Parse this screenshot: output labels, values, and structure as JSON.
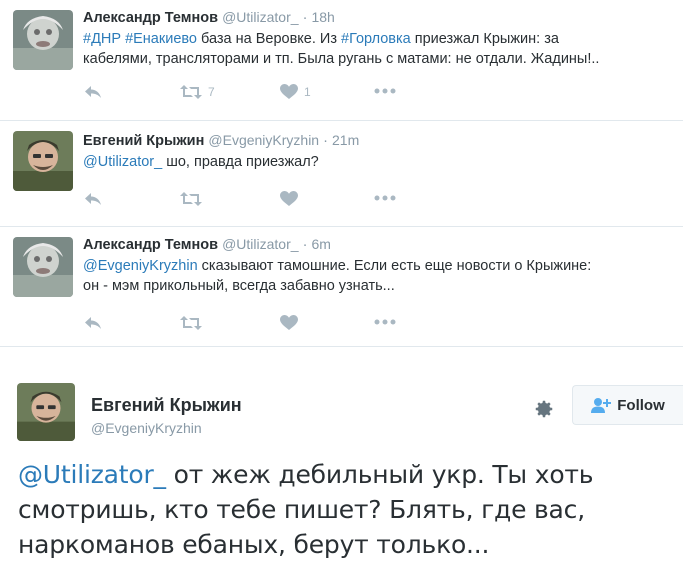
{
  "tweets": [
    {
      "name": "Александр Темнов",
      "handle": "@Utilizator_",
      "time": "18h",
      "hashtags": [
        "#ДНР",
        "#Енакиево"
      ],
      "text_part1": " база на Веровке. Из ",
      "hashtag2": "#Горловка",
      "text_part2": " приезжал Крыжин: за",
      "line2": "кабелями, трансляторами и тп. Была ругань с матами: не отдали. Жадины!..",
      "retweets": "7",
      "likes": "1"
    },
    {
      "name": "Евгений Крыжин",
      "handle": "@EvgeniyKryzhin",
      "time": "21m",
      "mention": "@Utilizator_",
      "text": " шо, правда приезжал?"
    },
    {
      "name": "Александр Темнов",
      "handle": "@Utilizator_",
      "time": "6m",
      "mention": "@EvgeniyKryzhin",
      "text": " сказывают тамошние. Если есть еще новости о Крыжине:",
      "line2": "он - мэм прикольный, всегда забавно узнать..."
    }
  ],
  "main_tweet": {
    "name": "Евгений Крыжин",
    "handle": "@EvgeniyKryzhin",
    "follow_label": "Follow",
    "mention": "@Utilizator_",
    "text_line1": " от жеж дебильный укр. Ты хоть",
    "text_line2": "смотришь, кто тебе пишет? Блять, где вас,",
    "text_line3": "наркоманов ебаных, берут только..."
  },
  "colors": {
    "link": "#2b7bb9",
    "icon": "#aab8c2",
    "name": "#292f33",
    "meta": "#8899a6"
  },
  "icons": [
    "reply-icon",
    "retweet-icon",
    "like-icon",
    "more-icon",
    "gear-icon",
    "follow-user-icon"
  ]
}
